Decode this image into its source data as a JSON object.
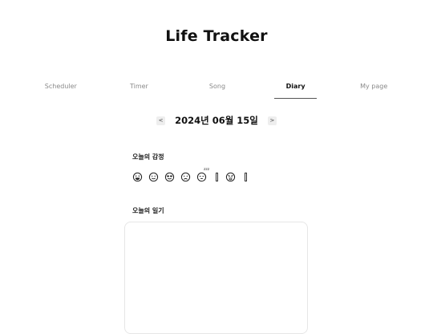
{
  "header": {
    "title": "Life Tracker"
  },
  "tabs": [
    {
      "label": "Scheduler",
      "active": false
    },
    {
      "label": "Timer",
      "active": false
    },
    {
      "label": "Song",
      "active": false
    },
    {
      "label": "Diary",
      "active": true
    },
    {
      "label": "My page",
      "active": false
    }
  ],
  "date_nav": {
    "prev_label": "<",
    "date": "2024년 06월 15일",
    "next_label": ">"
  },
  "emotion_section": {
    "label": "오늘의 감정",
    "icons": [
      "grinning-face-icon",
      "smiling-face-icon",
      "sunglasses-face-icon",
      "sad-face-icon",
      "sleepy-face-icon",
      "bar-icon",
      "angry-face-icon",
      "bar-icon"
    ],
    "sleep_mark": "zzz"
  },
  "diary_section": {
    "label": "오늘의 일기",
    "content": ""
  },
  "colors": {
    "text": "#111111",
    "muted": "#8a8a8a",
    "border": "#e6e6e6",
    "active_underline": "#555555"
  }
}
